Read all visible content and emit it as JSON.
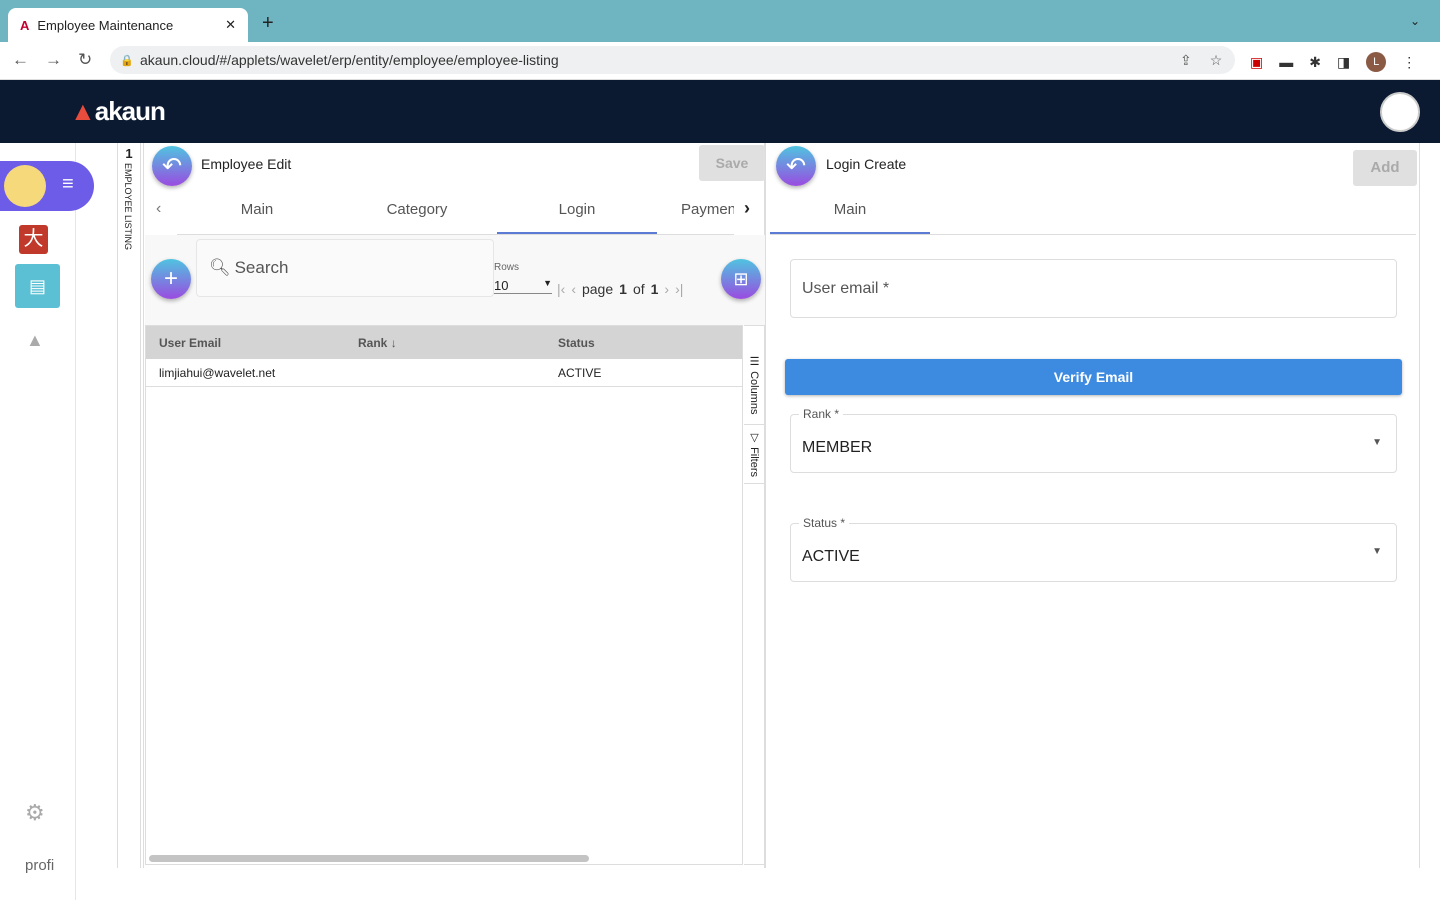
{
  "browser": {
    "tab_title": "Employee Maintenance",
    "url": "akaun.cloud/#/applets/wavelet/erp/entity/employee/employee-listing",
    "profile_initial": "L"
  },
  "app": {
    "logo": "akaun",
    "profile_img_alt": "profi"
  },
  "listing_strip": {
    "count": "1",
    "label": "EMPLOYEE LISTING"
  },
  "employee_edit": {
    "title": "Employee Edit",
    "save": "Save",
    "tabs": [
      "Main",
      "Category",
      "Login",
      "Paymen"
    ],
    "active_tab": 2
  },
  "login_list": {
    "search_placeholder": "Search",
    "rows_label": "Rows",
    "rows_value": "10",
    "page_label": "page",
    "page": "1",
    "of_label": "of",
    "total_pages": "1",
    "columns": [
      "User Email",
      "Rank",
      "Status"
    ],
    "rows": [
      {
        "email": "limjiahui@wavelet.net",
        "rank": "",
        "status": "ACTIVE"
      }
    ],
    "side_tabs": [
      "Columns",
      "Filters"
    ]
  },
  "login_create": {
    "title": "Login Create",
    "add": "Add",
    "tab": "Main",
    "email_placeholder": "User email *",
    "verify": "Verify Email",
    "rank_label": "Rank *",
    "rank_value": "MEMBER",
    "status_label": "Status *",
    "status_value": "ACTIVE"
  }
}
